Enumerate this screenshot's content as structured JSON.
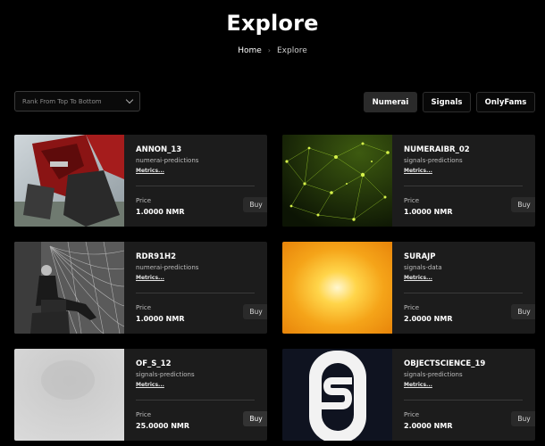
{
  "header": {
    "title": "Explore"
  },
  "breadcrumb": {
    "home": "Home",
    "separator": "›",
    "current": "Explore"
  },
  "sort_select": {
    "value": "Rank From Top To Bottom"
  },
  "tabs": [
    {
      "label": "Numerai",
      "active": true
    },
    {
      "label": "Signals",
      "active": false
    },
    {
      "label": "OnlyFams",
      "active": false
    }
  ],
  "cards": [
    {
      "name": "ANNON_13",
      "category": "numerai-predictions",
      "metrics": "Metrics...",
      "price_label": "Price",
      "price": "1.0000 NMR",
      "buy": "Buy",
      "image": "red-mech-robot"
    },
    {
      "name": "NUMERAIBR_02",
      "category": "signals-predictions",
      "metrics": "Metrics...",
      "price_label": "Price",
      "price": "1.0000 NMR",
      "buy": "Buy",
      "image": "green-network-mesh"
    },
    {
      "name": "RDR91H2",
      "category": "numerai-predictions",
      "metrics": "Metrics...",
      "price_label": "Price",
      "price": "1.0000 NMR",
      "buy": "Buy",
      "image": "vintage-photo-man-coil"
    },
    {
      "name": "SURAJP",
      "category": "signals-data",
      "metrics": "Metrics...",
      "price_label": "Price",
      "price": "2.0000 NMR",
      "buy": "Buy",
      "image": "orange-sun-gradient"
    },
    {
      "name": "OF_S_12",
      "category": "signals-predictions",
      "metrics": "Metrics...",
      "price_label": "Price",
      "price": "25.0000 NMR",
      "buy": "Buy",
      "image": "gray-noise-texture"
    },
    {
      "name": "OBJECTSCIENCE_19",
      "category": "signals-predictions",
      "metrics": "Metrics...",
      "price_label": "Price",
      "price": "2.0000 NMR",
      "buy": "Buy",
      "image": "s-logo-icon"
    }
  ]
}
